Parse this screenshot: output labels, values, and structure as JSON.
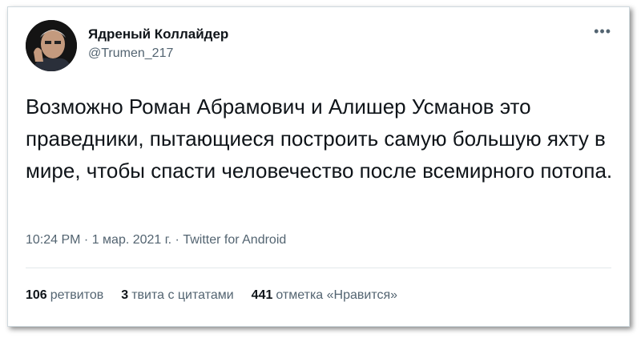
{
  "tweet": {
    "author_name": "Ядреный Коллайдер",
    "author_handle": "@Trumen_217",
    "more_icon": "•••",
    "text": "Возможно Роман Абрамович и Алишер Усманов это праведники, пытающиеся построить самую большую яхту в мире, чтобы спасти человечество после всемирного потопа.",
    "time": "10:24 PM",
    "sep1": " · ",
    "date": "1 мар. 2021 г.",
    "sep2": " · ",
    "source": "Twitter for Android",
    "stats": {
      "retweets_count": "106",
      "retweets_label": "ретвитов",
      "quotes_count": "3",
      "quotes_label": "твита с цитатами",
      "likes_count": "441",
      "likes_label": "отметка «Нравится»"
    }
  },
  "colors": {
    "text_primary": "#0f1419",
    "text_secondary": "#536471",
    "border": "#cfd9de"
  }
}
